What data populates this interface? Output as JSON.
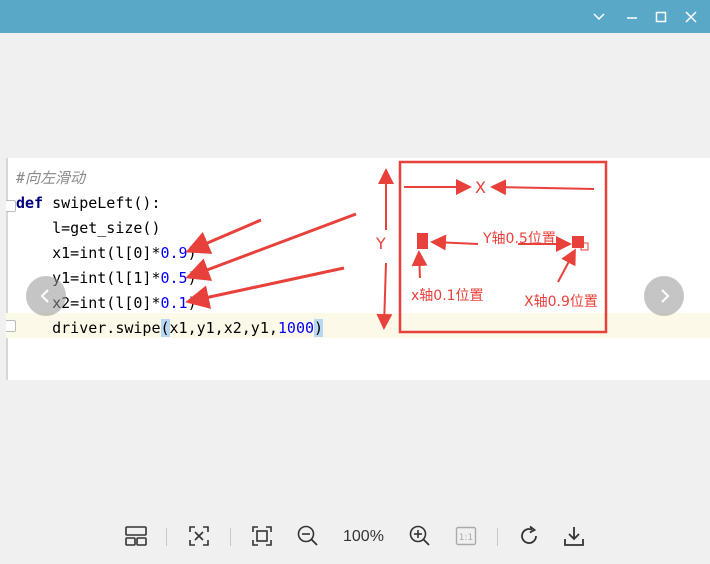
{
  "window": {
    "colors": {
      "titlebar": "#5aa8c8",
      "annotation": "#e8403a"
    },
    "controls": [
      "chevron-down-icon",
      "minimize-icon",
      "maximize-icon",
      "close-icon"
    ]
  },
  "code": {
    "comment": "#向左滑动",
    "def_keyword": "def",
    "func_sig": " swipeLeft():",
    "line_get_size": "    l=get_size()",
    "x1_prefix": "    x1=int(l[0]*",
    "x1_num": "0.9",
    "y1_prefix": "    y1=int(l[1]*",
    "y1_num": "0.5",
    "x2_prefix": "    x2=int(l[0]*",
    "x2_num": "0.1",
    "close_paren": ")",
    "swipe_prefix": "    driver.swipe",
    "swipe_open": "(",
    "swipe_args": "x1,y1,x2,y1,",
    "swipe_num": "1000",
    "swipe_close": ")"
  },
  "annotations": {
    "x_label": "X",
    "y_label": "Y",
    "y_axis_label": "Y轴0.5位置",
    "x01_label": "x轴0.1位置",
    "x09_label": "X轴0.9位置"
  },
  "viewer": {
    "zoom": "100%",
    "tools": [
      "layout-icon",
      "fit-icon",
      "actual-fit-icon",
      "zoom-out-icon",
      "zoom-in-icon",
      "one-to-one-icon",
      "rotate-icon",
      "download-icon"
    ]
  }
}
